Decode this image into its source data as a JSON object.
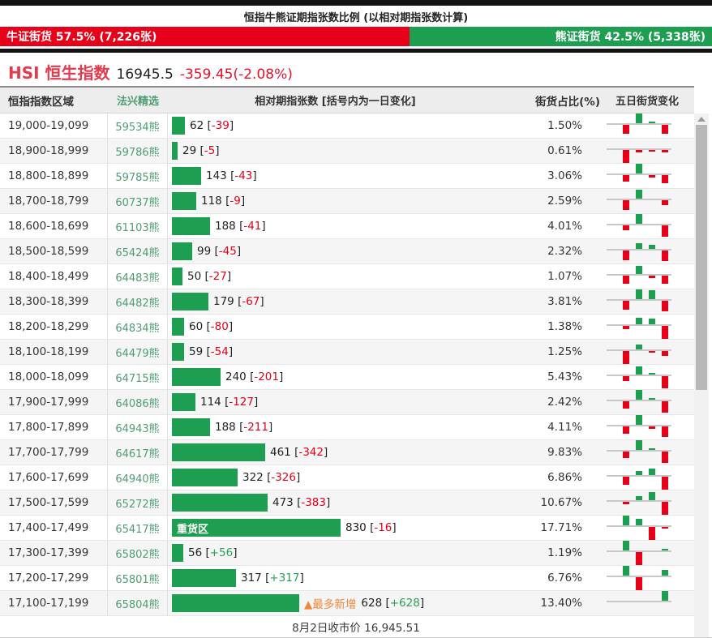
{
  "header": {
    "title": "恒指牛熊证期指张数比例 (以相对期指张数计算)",
    "bull_label": "牛证街货 57.5% (7,226张)",
    "bear_label": "熊证街货 42.5% (5,338张)",
    "bull_pct": 57.5,
    "bear_pct": 42.5,
    "bull_color": "#e60019",
    "bear_color": "#1e9e50"
  },
  "index": {
    "name": "HSI 恒生指数",
    "price": "16945.5",
    "change": "-359.45(-2.08%)"
  },
  "format": {
    "bracket_open": " [",
    "bracket_close": "]"
  },
  "table": {
    "columns": [
      "恒指指数区域",
      "法兴精选",
      "相对期指张数 [括号内为一日变化]",
      "街货占比(%)",
      "五日街货变化"
    ],
    "bar_scale": 0.25,
    "rows": [
      {
        "range": "19,000-19,099",
        "code": "59534熊",
        "value": 62,
        "change": "-39",
        "pct": "1.50%",
        "spark": [
          0,
          -0.7,
          1.0,
          0.1,
          -0.7
        ]
      },
      {
        "range": "18,900-18,999",
        "code": "59786熊",
        "value": 29,
        "change": "-5",
        "pct": "0.61%",
        "spark": [
          0,
          -1.0,
          -0.2,
          -0.12,
          -0.2
        ]
      },
      {
        "range": "18,800-18,899",
        "code": "59785熊",
        "value": 143,
        "change": "-43",
        "pct": "3.06%",
        "spark": [
          0,
          -0.5,
          1.0,
          -0.18,
          -0.65
        ]
      },
      {
        "range": "18,700-18,799",
        "code": "60737熊",
        "value": 118,
        "change": "-9",
        "pct": "2.59%",
        "spark": [
          0,
          -0.75,
          0.9,
          0,
          -0.35
        ]
      },
      {
        "range": "18,600-18,699",
        "code": "61103熊",
        "value": 188,
        "change": "-41",
        "pct": "4.01%",
        "spark": [
          0,
          -0.4,
          1.0,
          0,
          -0.9
        ]
      },
      {
        "range": "18,500-18,599",
        "code": "65424熊",
        "value": 99,
        "change": "-45",
        "pct": "2.32%",
        "spark": [
          0,
          -0.75,
          0.55,
          0.4,
          -0.8
        ]
      },
      {
        "range": "18,400-18,499",
        "code": "64483熊",
        "value": 50,
        "change": "-27",
        "pct": "1.07%",
        "spark": [
          0,
          -0.65,
          0.8,
          -0.18,
          -0.6
        ]
      },
      {
        "range": "18,300-18,399",
        "code": "64482熊",
        "value": 179,
        "change": "-67",
        "pct": "3.81%",
        "spark": [
          0,
          -0.7,
          1.0,
          0.9,
          -0.8
        ]
      },
      {
        "range": "18,200-18,299",
        "code": "64834熊",
        "value": 60,
        "change": "-80",
        "pct": "1.38%",
        "spark": [
          0,
          -0.22,
          0.7,
          0.55,
          -1.0
        ]
      },
      {
        "range": "18,100-18,199",
        "code": "64479熊",
        "value": 59,
        "change": "-54",
        "pct": "1.25%",
        "spark": [
          0,
          -1.0,
          0.5,
          -0.15,
          -0.4
        ]
      },
      {
        "range": "18,000-18,099",
        "code": "64715熊",
        "value": 240,
        "change": "-201",
        "pct": "5.43%",
        "spark": [
          0,
          -0.35,
          0.85,
          0.1,
          -0.95
        ]
      },
      {
        "range": "17,900-17,999",
        "code": "64086熊",
        "value": 114,
        "change": "-127",
        "pct": "2.42%",
        "spark": [
          0,
          -0.55,
          1.0,
          0.12,
          -0.85
        ]
      },
      {
        "range": "17,800-17,899",
        "code": "64943熊",
        "value": 188,
        "change": "-211",
        "pct": "4.11%",
        "spark": [
          0,
          -0.55,
          1.0,
          -0.2,
          -0.8
        ]
      },
      {
        "range": "17,700-17,799",
        "code": "64617熊",
        "value": 461,
        "change": "-342",
        "pct": "9.83%",
        "spark": [
          0,
          -0.5,
          1.0,
          0.15,
          -0.9
        ]
      },
      {
        "range": "17,600-17,699",
        "code": "64940熊",
        "value": 322,
        "change": "-326",
        "pct": "6.86%",
        "spark": [
          0,
          -0.6,
          0.45,
          0.7,
          -1.0
        ]
      },
      {
        "range": "17,500-17,599",
        "code": "65272熊",
        "value": 473,
        "change": "-383",
        "pct": "10.67%",
        "spark": [
          0,
          -0.2,
          0.4,
          0.8,
          -1.0
        ]
      },
      {
        "range": "17,400-17,499",
        "code": "65417熊",
        "value": 830,
        "change": "-16",
        "pct": "17.71%",
        "spark": [
          0,
          1.0,
          0.65,
          -1.0,
          -0.15
        ],
        "bar_tag": "重货区"
      },
      {
        "range": "17,300-17,399",
        "code": "65802熊",
        "value": 56,
        "change": "+56",
        "pct": "1.19%",
        "spark": [
          0,
          1.0,
          -1.0,
          0,
          0.1
        ]
      },
      {
        "range": "17,200-17,299",
        "code": "65801熊",
        "value": 317,
        "change": "+317",
        "pct": "6.76%",
        "spark": [
          0,
          1.0,
          -1.0,
          0,
          0.6
        ]
      },
      {
        "range": "17,100-17,199",
        "code": "65804熊",
        "value": 628,
        "change": "+628",
        "pct": "13.40%",
        "spark": [
          0,
          0,
          0,
          0,
          1.0
        ],
        "label_tag": "▲最多新增"
      }
    ]
  },
  "footer": {
    "text": "8月2日收市价 16,945.51"
  },
  "chart_data": {
    "type": "bar",
    "orientation": "horizontal",
    "title": "恒指牛熊证期指张数比例 (以相对期指张数计算)",
    "categories": [
      "19,000-19,099",
      "18,900-18,999",
      "18,800-18,899",
      "18,700-18,799",
      "18,600-18,699",
      "18,500-18,599",
      "18,400-18,499",
      "18,300-18,399",
      "18,200-18,299",
      "18,100-18,199",
      "18,000-18,099",
      "17,900-17,999",
      "17,800-17,899",
      "17,700-17,799",
      "17,600-17,699",
      "17,500-17,599",
      "17,400-17,499",
      "17,300-17,399",
      "17,200-17,299",
      "17,100-17,199"
    ],
    "series": [
      {
        "name": "相对期指张数",
        "values": [
          62,
          29,
          143,
          118,
          188,
          99,
          50,
          179,
          60,
          59,
          240,
          114,
          188,
          461,
          322,
          473,
          830,
          56,
          317,
          628
        ]
      },
      {
        "name": "一日变化",
        "values": [
          -39,
          -5,
          -43,
          -9,
          -41,
          -45,
          -27,
          -67,
          -80,
          -54,
          -201,
          -127,
          -211,
          -342,
          -326,
          -383,
          -16,
          56,
          317,
          628
        ]
      },
      {
        "name": "街货占比(%)",
        "values": [
          1.5,
          0.61,
          3.06,
          2.59,
          4.01,
          2.32,
          1.07,
          3.81,
          1.38,
          1.25,
          5.43,
          2.42,
          4.11,
          9.83,
          6.86,
          10.67,
          17.71,
          1.19,
          6.76,
          13.4
        ]
      }
    ],
    "annotations": [
      "重货区 @ 17,400-17,499",
      "▲最多新增 @ 17,100-17,199"
    ],
    "ratio": {
      "bull_pct": 57.5,
      "bull_lots": "7,226",
      "bear_pct": 42.5,
      "bear_lots": "5,338"
    },
    "bar_color": "#1e9e50",
    "negative_color": "#e60019",
    "positive_color": "#2aa052"
  }
}
